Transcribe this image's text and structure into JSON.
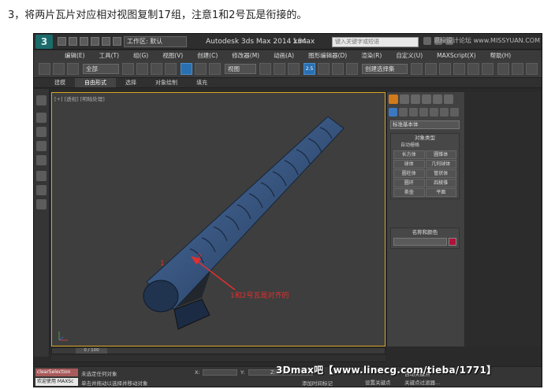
{
  "caption": "3，将两片瓦片对应相对视图复制17组，注意1和2号瓦是衔接的。",
  "app": {
    "logo_text": "3",
    "workspace_label": "工作区: 默认",
    "title": "Autodesk 3ds Max  2014 x64",
    "file_name": "1.max",
    "search_placeholder": "键入关键字或短语",
    "watermark_top": "思缘设计论坛  www.MISSYUAN.COM"
  },
  "menu": [
    "编辑(E)",
    "工具(T)",
    "组(G)",
    "视图(V)",
    "创建(C)",
    "修改器(M)",
    "动画(A)",
    "图形编辑器(D)",
    "渲染(R)",
    "自定义(U)",
    "MAXScript(X)",
    "帮助(H)"
  ],
  "toolbar": {
    "view_select": "视图",
    "selection_set": "创建选择集",
    "snap_label": "2.5"
  },
  "ribbon": [
    "建模",
    "自由形式",
    "选择",
    "对象绘制",
    "填充"
  ],
  "viewport": {
    "label": "[+] [透视] [明暗处理]",
    "annotation_1": "1",
    "annotation_2": "2",
    "annotation_text": "1和2号瓦是对齐的"
  },
  "command_panel": {
    "dropdown": "标准基本体",
    "object_type_title": "对象类型",
    "autogrid": "自动栅格",
    "buttons": [
      "长方体",
      "圆锥体",
      "球体",
      "几何球体",
      "圆柱体",
      "管状体",
      "圆环",
      "四棱锥",
      "茶壶",
      "平面"
    ],
    "name_color_title": "名称和颜色"
  },
  "timeline": {
    "slider_label": "0 / 100"
  },
  "status": {
    "script_a": "clearSelection",
    "script_b": "欢迎使用 MAXSc",
    "line1": "未选定任何对象",
    "line2": "单击并拖动以选择并移动对象",
    "x_label": "X:",
    "y_label": "Y:",
    "z_label": "Z:",
    "add_tag": "添加时间标记",
    "set_key": "设置关键点",
    "key_filter": "关键点过滤器...",
    "auto_key": "自动关键点"
  },
  "watermark_bottom": "3Dmax吧【www.linecg.com/tieba/1771】",
  "colors": {
    "accent": "#d27a1a",
    "annotation": "#e03030",
    "viewport_border": "#d9a520",
    "tile": "#2f4f78",
    "swatch": "#b0123a"
  }
}
